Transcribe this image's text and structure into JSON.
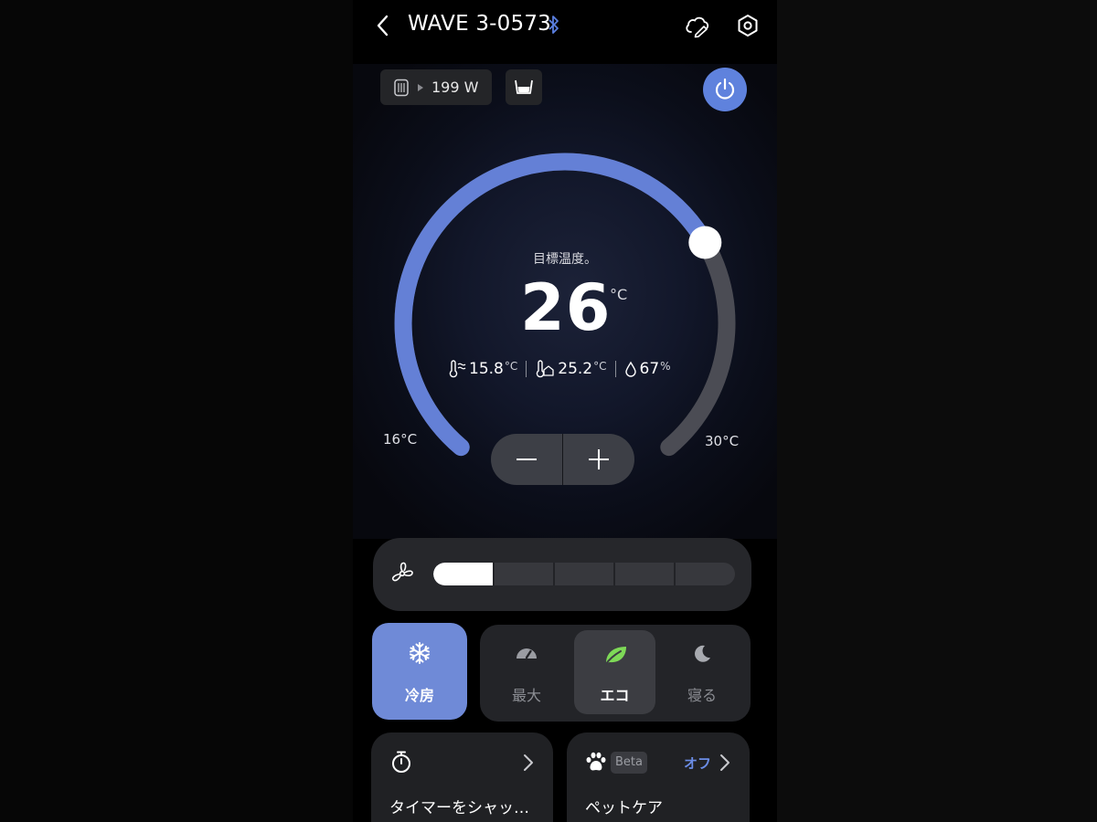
{
  "header": {
    "title": "WAVE 3-0573"
  },
  "status": {
    "power_draw": "199 W"
  },
  "dial": {
    "target_label": "目標温度。",
    "target_temp": "26",
    "unit": "°C",
    "min_label": "16°C",
    "max_label": "30°C",
    "min": 16,
    "max": 30,
    "value": 26
  },
  "readings": {
    "outdoor_temp": "15.8",
    "outdoor_unit": "°C",
    "indoor_temp": "25.2",
    "indoor_unit": "°C",
    "humidity": "67",
    "humidity_unit": "%"
  },
  "fan": {
    "levels": 5,
    "current_level": 1
  },
  "modes": {
    "cool_label": "冷房",
    "max_label": "最大",
    "eco_label": "エコ",
    "sleep_label": "寝る",
    "selected": "エコ"
  },
  "cards": {
    "timer_label": "タイマーをシャッ…",
    "pet_label": "ペットケア",
    "beta_badge": "Beta",
    "pet_status": "オフ"
  },
  "colors": {
    "accent": "#6480d6",
    "track": "#4b4c54",
    "cool_tile": "#6f8ad7",
    "eco_leaf": "#7ed957",
    "pet_status": "#6b8de6"
  }
}
